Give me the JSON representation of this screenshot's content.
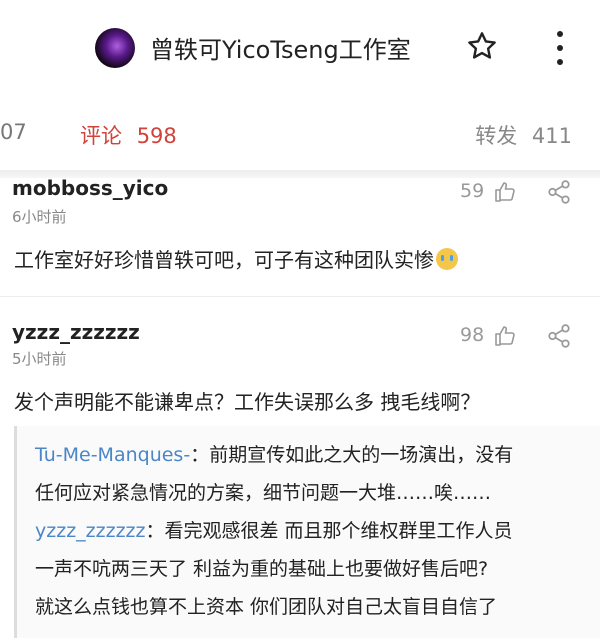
{
  "header": {
    "title": "曾轶可YicoTseng工作室",
    "icons": [
      "avatar",
      "star-icon",
      "more-vertical-icon"
    ]
  },
  "tabs": {
    "partial_left": "07",
    "comment_label": "评论",
    "comment_count": "598",
    "repost_label": "转发",
    "repost_count": "411"
  },
  "comments": [
    {
      "user": "mobboss_yico",
      "time": "6小时前",
      "likes": "59",
      "text": "工作室好好珍惜曾轶可吧，可子有这种团队实惨",
      "emoji": "crying-face"
    },
    {
      "user": "yzzz_zzzzzz",
      "time": "5小时前",
      "likes": "98",
      "text": "发个声明能不能谦卑点？工作失误那么多 拽毛线啊？",
      "replies": [
        {
          "user": "Tu-Me-Manques-",
          "text_line1": "：前期宣传如此之大的一场演出，没有",
          "text_line2": "任何应对紧急情况的方案，细节问题一大堆……唉……"
        },
        {
          "user": "yzzz_zzzzzz",
          "text_line1": "：看完观感很差 而且那个维权群里工作人员",
          "text_line2": "一声不吭两三天了 利益为重的基础上也要做好售后吧?",
          "text_line3": "就这么点钱也算不上资本 你们团队对自己太盲目自信了"
        }
      ]
    }
  ],
  "colors": {
    "accent_red": "#d0423a",
    "reply_name_blue": "#4a86c8",
    "muted_gray": "#888888"
  }
}
